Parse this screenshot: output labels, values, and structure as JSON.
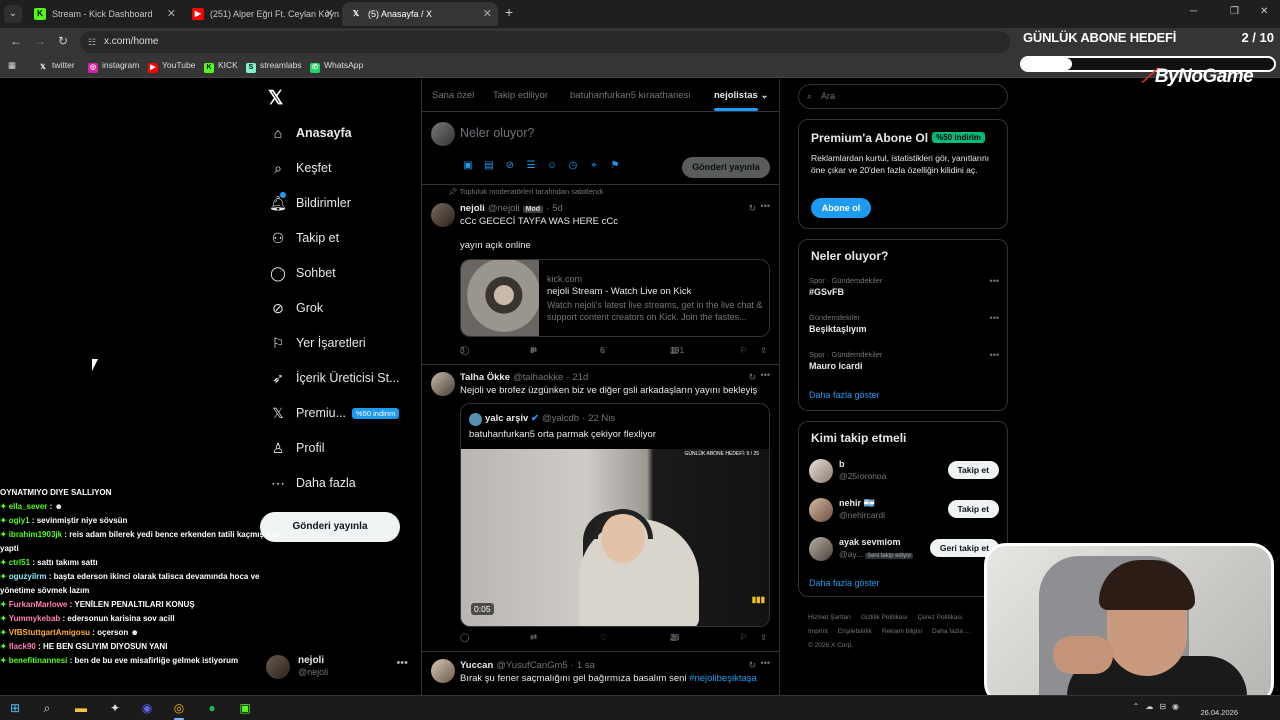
{
  "browser": {
    "tabs": [
      {
        "label": "Stream - Kick Dashboard",
        "icon": "kick-icon",
        "color": "#53fc18"
      },
      {
        "label": "(251) Alper Eğri Ft. Ceylan Koyn...",
        "icon": "youtube-icon",
        "color": "#ff0000"
      },
      {
        "label": "(5) Anasayfa / X",
        "icon": "x-icon",
        "color": "#ffffff"
      }
    ],
    "active_tab": 2,
    "url": "x.com/home",
    "bookmarks": [
      {
        "label": "twitter",
        "icon": "x-icon"
      },
      {
        "label": "instagram",
        "icon": "instagram-icon"
      },
      {
        "label": "YouTube",
        "icon": "youtube-icon"
      },
      {
        "label": "KICK",
        "icon": "kick-icon"
      },
      {
        "label": "streamlabs",
        "icon": "streamlabs-icon"
      },
      {
        "label": "WhatsApp",
        "icon": "whatsapp-icon"
      }
    ]
  },
  "overlay": {
    "goal_title": "GÜNLÜK ABONE HEDEFİ",
    "goal_count": "2 / 10",
    "goal_progress": 0.2,
    "brand": "ByNoGame"
  },
  "sidebar": {
    "items": [
      {
        "label": "Anasayfa",
        "icon": "home-icon"
      },
      {
        "label": "Keşfet",
        "icon": "search-icon"
      },
      {
        "label": "Bildirimler",
        "icon": "bell-icon"
      },
      {
        "label": "Takip et",
        "icon": "person-add-icon"
      },
      {
        "label": "Sohbet",
        "icon": "chat-icon"
      },
      {
        "label": "Grok",
        "icon": "grok-icon"
      },
      {
        "label": "Yer İşaretleri",
        "icon": "bookmark-icon"
      },
      {
        "label": "İçerik Üreticisi St...",
        "icon": "rocket-icon"
      },
      {
        "label": "Premiu...",
        "icon": "x-premium-icon",
        "badge": "%50 indirim"
      },
      {
        "label": "Profil",
        "icon": "profile-icon"
      },
      {
        "label": "Daha fazla",
        "icon": "more-circle-icon"
      }
    ],
    "post_button": "Gönderi yayınla",
    "account": {
      "name": "nejoli",
      "handle": "@nejoli"
    }
  },
  "feed": {
    "tabs": [
      "Sana özel",
      "Takip ediliyor",
      "batuhanfurkan5 kıraathanesi",
      "nejolistas"
    ],
    "active_tab": "nejolistas",
    "composer_placeholder": "Neler oluyor?",
    "composer_button": "Gönderi yayınla",
    "pinned_label": "Topluluk moderatörleri tarafından sabitlendi",
    "posts": [
      {
        "name": "nejoli",
        "handle": "@nejoli",
        "badge": "Mod",
        "time": "5d",
        "text1": "cCc GECECİ TAYFA WAS HERE cCc",
        "text2": "yayın açık online",
        "card": {
          "domain": "kick.com",
          "title": "nejoli Stream - Watch Live on Kick",
          "description": "Watch nejoli's latest live streams, get in the live chat & support content creators on Kick. Join the fastes..."
        },
        "replies": "3",
        "reposts": "3",
        "likes": "6",
        "views": "191"
      },
      {
        "name": "Talha Ökke",
        "handle": "@talhaokke",
        "time": "21d",
        "text1": "Nejoli ve brofez üzgünken biz ve diğer gsli arkadaşların yayını bekleyiş",
        "quote": {
          "name": "yalc arşiv",
          "handle": "@yalcdb",
          "time": "22 Nis",
          "text": "batuhanfurkan5 orta parmak çekiyor flexliyor",
          "video_time": "0:05",
          "video_goal": "GÜNLÜK ABONE HEDEFİ: 9 / 25"
        },
        "replies": "",
        "reposts": "",
        "likes": "",
        "views": "26"
      },
      {
        "name": "Yuccan",
        "handle": "@YusufCanGm5",
        "time": "1 sa",
        "text1": "Bırak şu fener saçmalığını gel bağırmıza basalım seni",
        "hashtag": "#nejolibeşiktaşa"
      }
    ]
  },
  "right": {
    "search_placeholder": "Ara",
    "premium": {
      "title": "Premium'a Abone Ol",
      "badge": "%50 indirim",
      "text": "Reklamlardan kurtul, istatistikleri gör, yanıtlarını öne çıkar ve 20'den fazla özelliğin kilidini aç.",
      "button": "Abone ol"
    },
    "trends_title": "Neler oluyor?",
    "trends": [
      {
        "category": "Spor · Gündemdekiler",
        "name": "#GSvFB"
      },
      {
        "category": "Gündemdekiler",
        "name": "Beşiktaşlıyım"
      },
      {
        "category": "Spor · Gündemdekiler",
        "name": "Mauro Icardi"
      }
    ],
    "show_more": "Daha fazla göster",
    "who_title": "Kimi takip etmeli",
    "who": [
      {
        "name": "b",
        "handle": "@25roronoa",
        "button": "Takip et"
      },
      {
        "name": "nehir 🇦🇷",
        "handle": "@nehircardi",
        "button": "Takip et"
      },
      {
        "name": "ayak sevmiom",
        "handle": "@ay...",
        "follows_you": "Seni takip ediyor",
        "button": "Geri takip et"
      }
    ],
    "who_more": "Daha fazla göster",
    "footer": [
      "Hizmet Şartları",
      "Gizlilik Politikası",
      "Çerez Politikası",
      "Imprint",
      "Erişilebilirlik",
      "Reklam bilgisi",
      "Daha fazla ...",
      "© 2026 X Corp."
    ]
  },
  "chat": [
    {
      "user": "",
      "text": "OYNATMIYO DIYE SALLIYON"
    },
    {
      "user": "ella_sever",
      "text": " : ☻",
      "color": "green"
    },
    {
      "user": "ogiy1",
      "text": " : sevinmiştir niye sövsün",
      "color": "green"
    },
    {
      "user": "ibrahim1903jk",
      "text": " : reis adam bilerek yedi bence erkenden tatili kaçmış için yapti",
      "color": "green",
      "wrap": true
    },
    {
      "user": "ctrl51",
      "text": " : sattı takımı sattı",
      "color": "green"
    },
    {
      "user": "oguzyilrm",
      "text": " : başta ederson ikinci olarak talisca devamında hoca ve yönetime sövmek lazım",
      "color": "cyan",
      "wrap": true
    },
    {
      "user": "FurkanMarlowe",
      "text": " : YENİLEN PENALTILARI KONUŞ",
      "color": "pink"
    },
    {
      "user": "Yummykebab",
      "text": " : edersonun karisina sov acill",
      "color": "pink"
    },
    {
      "user": "VfBStuttgartAmigosu",
      "text": " : oçerson ☻",
      "color": "orange"
    },
    {
      "user": "flack90",
      "text": " : HE BEN GSLIYIM DIYOSUN YANI",
      "color": "pink"
    },
    {
      "user": "benefitinannesi",
      "text": " : ben de bu eve misafirliğe gelmek istiyorum",
      "color": "green"
    }
  ],
  "taskbar": {
    "date": "26.04.2026",
    "apps": [
      "windows-icon",
      "search-icon",
      "file-explorer-icon",
      "app-icon",
      "discord-icon",
      "chrome-icon",
      "spotify-icon",
      "kick-app-icon"
    ]
  }
}
